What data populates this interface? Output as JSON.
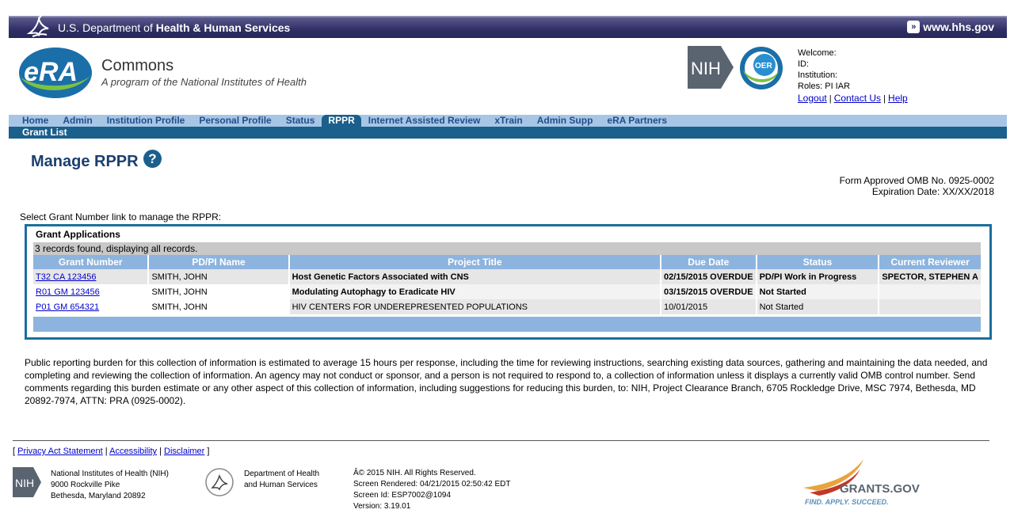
{
  "hhs": {
    "dept_prefix": "U.S. Department of",
    "dept_bold": "Health & Human Services",
    "link": "www.hhs.gov"
  },
  "era": {
    "title": "Commons",
    "subtitle": "A program of the National Institutes of Health"
  },
  "welcome": {
    "welcome": "Welcome:",
    "id": "ID:",
    "institution": "Institution:",
    "roles": "Roles:  PI  IAR",
    "logout": "Logout",
    "contact": "Contact Us",
    "help": "Help"
  },
  "nav": {
    "items": [
      "Home",
      "Admin",
      "Institution Profile",
      "Personal Profile",
      "Status",
      "RPPR",
      "Internet Assisted Review",
      "xTrain",
      "Admin Supp",
      "eRA Partners"
    ],
    "active": "RPPR",
    "sub": "Grant List"
  },
  "page": {
    "title": "Manage RPPR",
    "help_glyph": "?",
    "omb_line1": "Form Approved OMB No. 0925-0002",
    "omb_line2": "Expiration Date: XX/XX/2018",
    "instruction": "Select Grant Number link to manage the RPPR:"
  },
  "grid": {
    "caption": "Grant Applications",
    "count": "3 records found, displaying all records.",
    "headers": [
      "Grant Number",
      "PD/PI Name",
      "Project Title",
      "Due Date",
      "Status",
      "Current Reviewer"
    ],
    "rows": [
      {
        "grant": "T32 CA 123456",
        "pi": "SMITH, JOHN",
        "title": "Host Genetic Factors Associated with CNS",
        "due": "02/15/2015  OVERDUE",
        "status": "PD/PI Work in Progress",
        "reviewer": "SPECTOR, STEPHEN A"
      },
      {
        "grant": "R01 GM 123456",
        "pi": "SMITH, JOHN",
        "title": "Modulating Autophagy to Eradicate HIV",
        "due": "03/15/2015  OVERDUE",
        "status": "Not Started",
        "reviewer": ""
      },
      {
        "grant": "P01 GM 654321",
        "pi": "SMITH, JOHN",
        "title": "HIV CENTERS FOR UNDEREPRESENTED POPULATIONS",
        "due": "10/01/2015",
        "status": "Not Started",
        "reviewer": ""
      }
    ]
  },
  "burden": "Public reporting burden for this collection of information is estimated to average 15 hours per response, including the time for reviewing instructions, searching existing data sources, gathering and maintaining the data needed, and completing and reviewing the collection of information.  An agency may not conduct or sponsor, and a person is not required to respond to, a collection of information unless it displays a currently valid OMB control number.  Send comments regarding this burden estimate or any other aspect of this collection of information, including suggestions for reducing this burden, to: NIH, Project Clearance Branch, 6705 Rockledge Drive, MSC 7974, Bethesda, MD 20892-7974, ATTN: PRA (0925-0002).",
  "footer": {
    "privacy": "Privacy Act Statement",
    "accessibility": "Accessibility",
    "disclaimer": "Disclaimer",
    "nih_line1": "National Institutes of Health (NIH)",
    "nih_line2": "9000 Rockville Pike",
    "nih_line3": "Bethesda, Maryland 20892",
    "hhs_line1": "Department of Health",
    "hhs_line2": "and Human Services",
    "copyright": "Â© 2015 NIH. All Rights Reserved.",
    "rendered": "Screen Rendered: 04/21/2015 02:50:42 EDT",
    "screen_id": "Screen Id: ESP7002@1094",
    "version": "Version: 3.19.01",
    "grants_name": "GRANTS.GOV",
    "grants_tag": "FIND. APPLY. SUCCEED."
  },
  "logos": {
    "nih_mark": "NIH",
    "oer_mark": "OER",
    "era_mark": "eRA"
  },
  "colors": {
    "nav_bg": "#a7c6e5",
    "nav_active": "#1b5f8c",
    "grid_header": "#8db4de",
    "title": "#1b3f6e"
  }
}
